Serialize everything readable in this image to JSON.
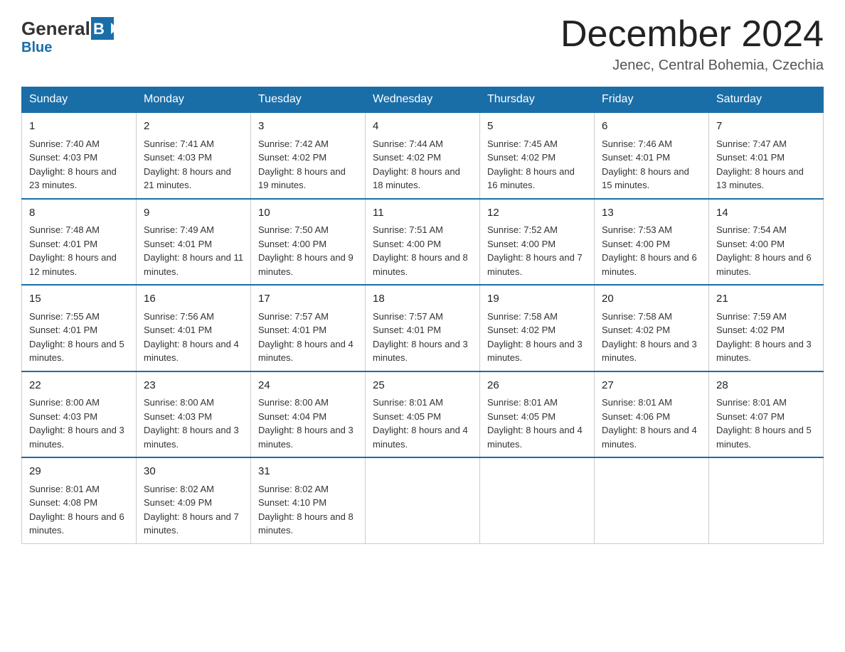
{
  "header": {
    "logo_general": "General",
    "logo_blue": "Blue",
    "month_title": "December 2024",
    "subtitle": "Jenec, Central Bohemia, Czechia"
  },
  "columns": [
    "Sunday",
    "Monday",
    "Tuesday",
    "Wednesday",
    "Thursday",
    "Friday",
    "Saturday"
  ],
  "weeks": [
    [
      {
        "day": "1",
        "sunrise": "Sunrise: 7:40 AM",
        "sunset": "Sunset: 4:03 PM",
        "daylight": "Daylight: 8 hours and 23 minutes."
      },
      {
        "day": "2",
        "sunrise": "Sunrise: 7:41 AM",
        "sunset": "Sunset: 4:03 PM",
        "daylight": "Daylight: 8 hours and 21 minutes."
      },
      {
        "day": "3",
        "sunrise": "Sunrise: 7:42 AM",
        "sunset": "Sunset: 4:02 PM",
        "daylight": "Daylight: 8 hours and 19 minutes."
      },
      {
        "day": "4",
        "sunrise": "Sunrise: 7:44 AM",
        "sunset": "Sunset: 4:02 PM",
        "daylight": "Daylight: 8 hours and 18 minutes."
      },
      {
        "day": "5",
        "sunrise": "Sunrise: 7:45 AM",
        "sunset": "Sunset: 4:02 PM",
        "daylight": "Daylight: 8 hours and 16 minutes."
      },
      {
        "day": "6",
        "sunrise": "Sunrise: 7:46 AM",
        "sunset": "Sunset: 4:01 PM",
        "daylight": "Daylight: 8 hours and 15 minutes."
      },
      {
        "day": "7",
        "sunrise": "Sunrise: 7:47 AM",
        "sunset": "Sunset: 4:01 PM",
        "daylight": "Daylight: 8 hours and 13 minutes."
      }
    ],
    [
      {
        "day": "8",
        "sunrise": "Sunrise: 7:48 AM",
        "sunset": "Sunset: 4:01 PM",
        "daylight": "Daylight: 8 hours and 12 minutes."
      },
      {
        "day": "9",
        "sunrise": "Sunrise: 7:49 AM",
        "sunset": "Sunset: 4:01 PM",
        "daylight": "Daylight: 8 hours and 11 minutes."
      },
      {
        "day": "10",
        "sunrise": "Sunrise: 7:50 AM",
        "sunset": "Sunset: 4:00 PM",
        "daylight": "Daylight: 8 hours and 9 minutes."
      },
      {
        "day": "11",
        "sunrise": "Sunrise: 7:51 AM",
        "sunset": "Sunset: 4:00 PM",
        "daylight": "Daylight: 8 hours and 8 minutes."
      },
      {
        "day": "12",
        "sunrise": "Sunrise: 7:52 AM",
        "sunset": "Sunset: 4:00 PM",
        "daylight": "Daylight: 8 hours and 7 minutes."
      },
      {
        "day": "13",
        "sunrise": "Sunrise: 7:53 AM",
        "sunset": "Sunset: 4:00 PM",
        "daylight": "Daylight: 8 hours and 6 minutes."
      },
      {
        "day": "14",
        "sunrise": "Sunrise: 7:54 AM",
        "sunset": "Sunset: 4:00 PM",
        "daylight": "Daylight: 8 hours and 6 minutes."
      }
    ],
    [
      {
        "day": "15",
        "sunrise": "Sunrise: 7:55 AM",
        "sunset": "Sunset: 4:01 PM",
        "daylight": "Daylight: 8 hours and 5 minutes."
      },
      {
        "day": "16",
        "sunrise": "Sunrise: 7:56 AM",
        "sunset": "Sunset: 4:01 PM",
        "daylight": "Daylight: 8 hours and 4 minutes."
      },
      {
        "day": "17",
        "sunrise": "Sunrise: 7:57 AM",
        "sunset": "Sunset: 4:01 PM",
        "daylight": "Daylight: 8 hours and 4 minutes."
      },
      {
        "day": "18",
        "sunrise": "Sunrise: 7:57 AM",
        "sunset": "Sunset: 4:01 PM",
        "daylight": "Daylight: 8 hours and 3 minutes."
      },
      {
        "day": "19",
        "sunrise": "Sunrise: 7:58 AM",
        "sunset": "Sunset: 4:02 PM",
        "daylight": "Daylight: 8 hours and 3 minutes."
      },
      {
        "day": "20",
        "sunrise": "Sunrise: 7:58 AM",
        "sunset": "Sunset: 4:02 PM",
        "daylight": "Daylight: 8 hours and 3 minutes."
      },
      {
        "day": "21",
        "sunrise": "Sunrise: 7:59 AM",
        "sunset": "Sunset: 4:02 PM",
        "daylight": "Daylight: 8 hours and 3 minutes."
      }
    ],
    [
      {
        "day": "22",
        "sunrise": "Sunrise: 8:00 AM",
        "sunset": "Sunset: 4:03 PM",
        "daylight": "Daylight: 8 hours and 3 minutes."
      },
      {
        "day": "23",
        "sunrise": "Sunrise: 8:00 AM",
        "sunset": "Sunset: 4:03 PM",
        "daylight": "Daylight: 8 hours and 3 minutes."
      },
      {
        "day": "24",
        "sunrise": "Sunrise: 8:00 AM",
        "sunset": "Sunset: 4:04 PM",
        "daylight": "Daylight: 8 hours and 3 minutes."
      },
      {
        "day": "25",
        "sunrise": "Sunrise: 8:01 AM",
        "sunset": "Sunset: 4:05 PM",
        "daylight": "Daylight: 8 hours and 4 minutes."
      },
      {
        "day": "26",
        "sunrise": "Sunrise: 8:01 AM",
        "sunset": "Sunset: 4:05 PM",
        "daylight": "Daylight: 8 hours and 4 minutes."
      },
      {
        "day": "27",
        "sunrise": "Sunrise: 8:01 AM",
        "sunset": "Sunset: 4:06 PM",
        "daylight": "Daylight: 8 hours and 4 minutes."
      },
      {
        "day": "28",
        "sunrise": "Sunrise: 8:01 AM",
        "sunset": "Sunset: 4:07 PM",
        "daylight": "Daylight: 8 hours and 5 minutes."
      }
    ],
    [
      {
        "day": "29",
        "sunrise": "Sunrise: 8:01 AM",
        "sunset": "Sunset: 4:08 PM",
        "daylight": "Daylight: 8 hours and 6 minutes."
      },
      {
        "day": "30",
        "sunrise": "Sunrise: 8:02 AM",
        "sunset": "Sunset: 4:09 PM",
        "daylight": "Daylight: 8 hours and 7 minutes."
      },
      {
        "day": "31",
        "sunrise": "Sunrise: 8:02 AM",
        "sunset": "Sunset: 4:10 PM",
        "daylight": "Daylight: 8 hours and 8 minutes."
      },
      null,
      null,
      null,
      null
    ]
  ]
}
